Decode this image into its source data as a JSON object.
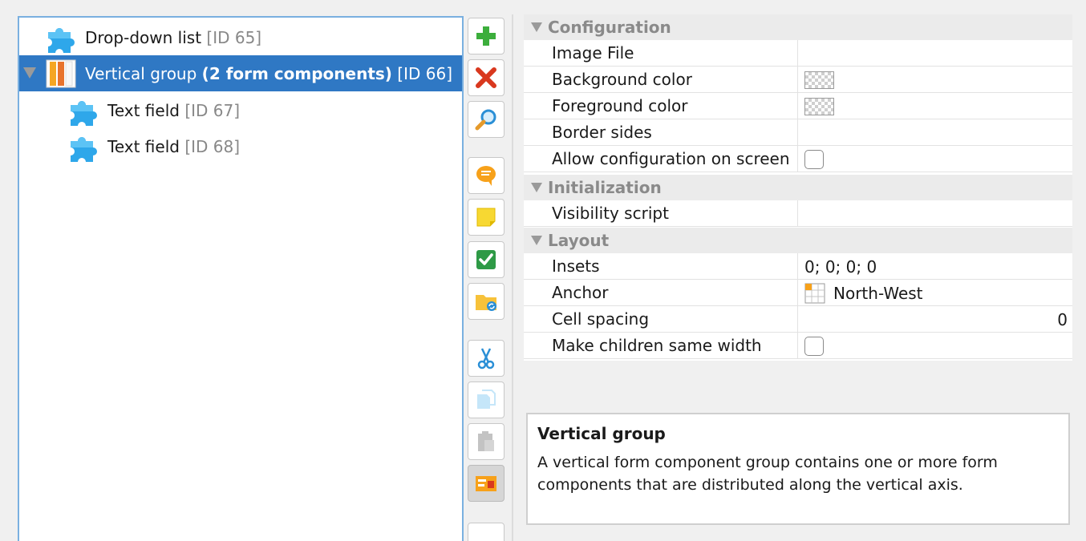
{
  "tree": {
    "items": [
      {
        "label": "Drop-down list",
        "id_text": "[ID 65]",
        "icon": "puzzle-icon"
      },
      {
        "label": "Vertical group",
        "bold_text": "(2 form components)",
        "id_text": "[ID 66]",
        "icon": "vertical-group-icon",
        "selected": true,
        "expanded": true
      },
      {
        "label": "Text field",
        "id_text": "[ID 67]",
        "icon": "puzzle-icon"
      },
      {
        "label": "Text field",
        "id_text": "[ID 68]",
        "icon": "puzzle-icon"
      }
    ]
  },
  "toolbar": {
    "buttons": [
      {
        "name": "add",
        "icon": "plus-icon"
      },
      {
        "name": "delete",
        "icon": "red-x-icon"
      },
      {
        "name": "find",
        "icon": "magnifier-icon"
      },
      {
        "name": "comment",
        "icon": "speech-bubble-icon"
      },
      {
        "name": "note",
        "icon": "sticky-note-icon"
      },
      {
        "name": "check",
        "icon": "checkmark-icon"
      },
      {
        "name": "folder",
        "icon": "folder-sync-icon"
      },
      {
        "name": "cut",
        "icon": "scissors-icon"
      },
      {
        "name": "copy",
        "icon": "copy-icon",
        "disabled": true
      },
      {
        "name": "paste",
        "icon": "clipboard-icon",
        "disabled": true
      },
      {
        "name": "preview",
        "icon": "form-preview-icon",
        "pressed": true
      }
    ]
  },
  "properties": {
    "sections": [
      {
        "title": "Configuration",
        "rows": [
          {
            "name": "Image File",
            "value": ""
          },
          {
            "name": "Background color",
            "value_type": "color"
          },
          {
            "name": "Foreground color",
            "value_type": "color"
          },
          {
            "name": "Border sides",
            "value": ""
          },
          {
            "name": "Allow configuration on screen",
            "value_type": "checkbox",
            "checked": false
          }
        ]
      },
      {
        "title": "Initialization",
        "rows": [
          {
            "name": "Visibility script",
            "value": ""
          }
        ]
      },
      {
        "title": "Layout",
        "rows": [
          {
            "name": "Insets",
            "value": "0; 0; 0; 0"
          },
          {
            "name": "Anchor",
            "value": "North-West",
            "icon": "anchor-grid-icon"
          },
          {
            "name": "Cell spacing",
            "value": "0",
            "align": "right"
          },
          {
            "name": "Make children same width",
            "value_type": "checkbox",
            "checked": false
          }
        ]
      }
    ]
  },
  "description": {
    "title": "Vertical group",
    "text": "A vertical form component group contains one or more form components that are distributed along the vertical axis."
  },
  "colors": {
    "selection": "#2f78c4",
    "tree_border": "#7ab0e0",
    "section_text": "#8a8a8a"
  }
}
